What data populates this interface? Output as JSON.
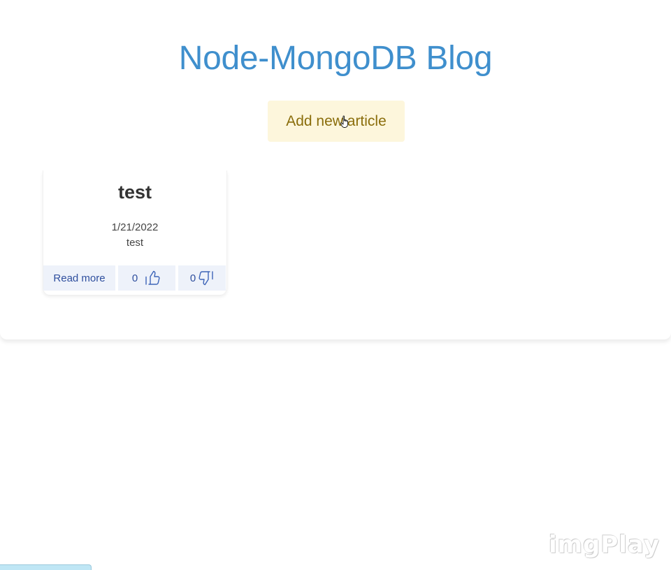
{
  "header": {
    "title": "Node-MongoDB Blog",
    "add_button_label": "Add new article"
  },
  "articles": [
    {
      "title": "test",
      "date": "1/21/2022",
      "body": "test",
      "read_more_label": "Read more",
      "likes": "0",
      "dislikes": "0"
    }
  ],
  "watermark": "imgPlay",
  "colors": {
    "title": "#3f8fcd",
    "add_button_bg": "#fdf6dc",
    "add_button_text": "#8a6d0b",
    "action_bg": "#eef2fa",
    "action_text": "#2f4f9e"
  },
  "icons": {
    "cursor": "hand-pointer-icon",
    "like": "thumbs-up-icon",
    "dislike": "thumbs-down-icon"
  }
}
